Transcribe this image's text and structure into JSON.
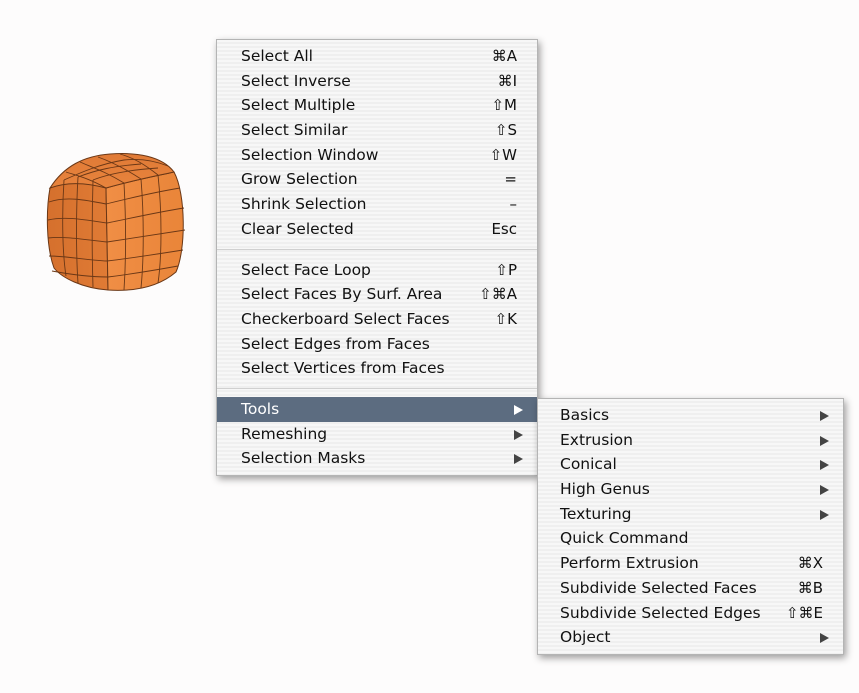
{
  "scene": {
    "object_icon": "subdivided-cube-icon",
    "object_color": "#e8843a"
  },
  "main_menu": {
    "groups": [
      [
        {
          "label": "Select All",
          "shortcut": "⌘A"
        },
        {
          "label": "Select Inverse",
          "shortcut": "⌘I"
        },
        {
          "label": "Select Multiple",
          "shortcut": "⇧M"
        },
        {
          "label": "Select Similar",
          "shortcut": "⇧S"
        },
        {
          "label": "Selection Window",
          "shortcut": "⇧W"
        },
        {
          "label": "Grow Selection",
          "shortcut": "="
        },
        {
          "label": "Shrink Selection",
          "shortcut": "–"
        },
        {
          "label": "Clear Selected",
          "shortcut": "Esc"
        }
      ],
      [
        {
          "label": "Select Face Loop",
          "shortcut": "⇧P"
        },
        {
          "label": "Select Faces By Surf. Area",
          "shortcut": "⇧⌘A"
        },
        {
          "label": "Checkerboard Select Faces",
          "shortcut": "⇧K"
        },
        {
          "label": "Select Edges from Faces",
          "shortcut": ""
        },
        {
          "label": "Select Vertices from Faces",
          "shortcut": ""
        }
      ],
      [
        {
          "label": "Tools",
          "submenu": true,
          "highlighted": true
        },
        {
          "label": "Remeshing",
          "submenu": true
        },
        {
          "label": "Selection Masks",
          "submenu": true
        }
      ]
    ],
    "highlight_color": "#5c6c80"
  },
  "tools_submenu": {
    "items": [
      {
        "label": "Basics",
        "submenu": true
      },
      {
        "label": "Extrusion",
        "submenu": true
      },
      {
        "label": "Conical",
        "submenu": true
      },
      {
        "label": "High Genus",
        "submenu": true
      },
      {
        "label": "Texturing",
        "submenu": true
      },
      {
        "label": "Quick Command",
        "shortcut": ""
      },
      {
        "label": "Perform Extrusion",
        "shortcut": "⌘X"
      },
      {
        "label": "Subdivide Selected Faces",
        "shortcut": "⌘B"
      },
      {
        "label": "Subdivide Selected Edges",
        "shortcut": "⇧⌘E"
      },
      {
        "label": "Object",
        "submenu": true
      }
    ]
  }
}
